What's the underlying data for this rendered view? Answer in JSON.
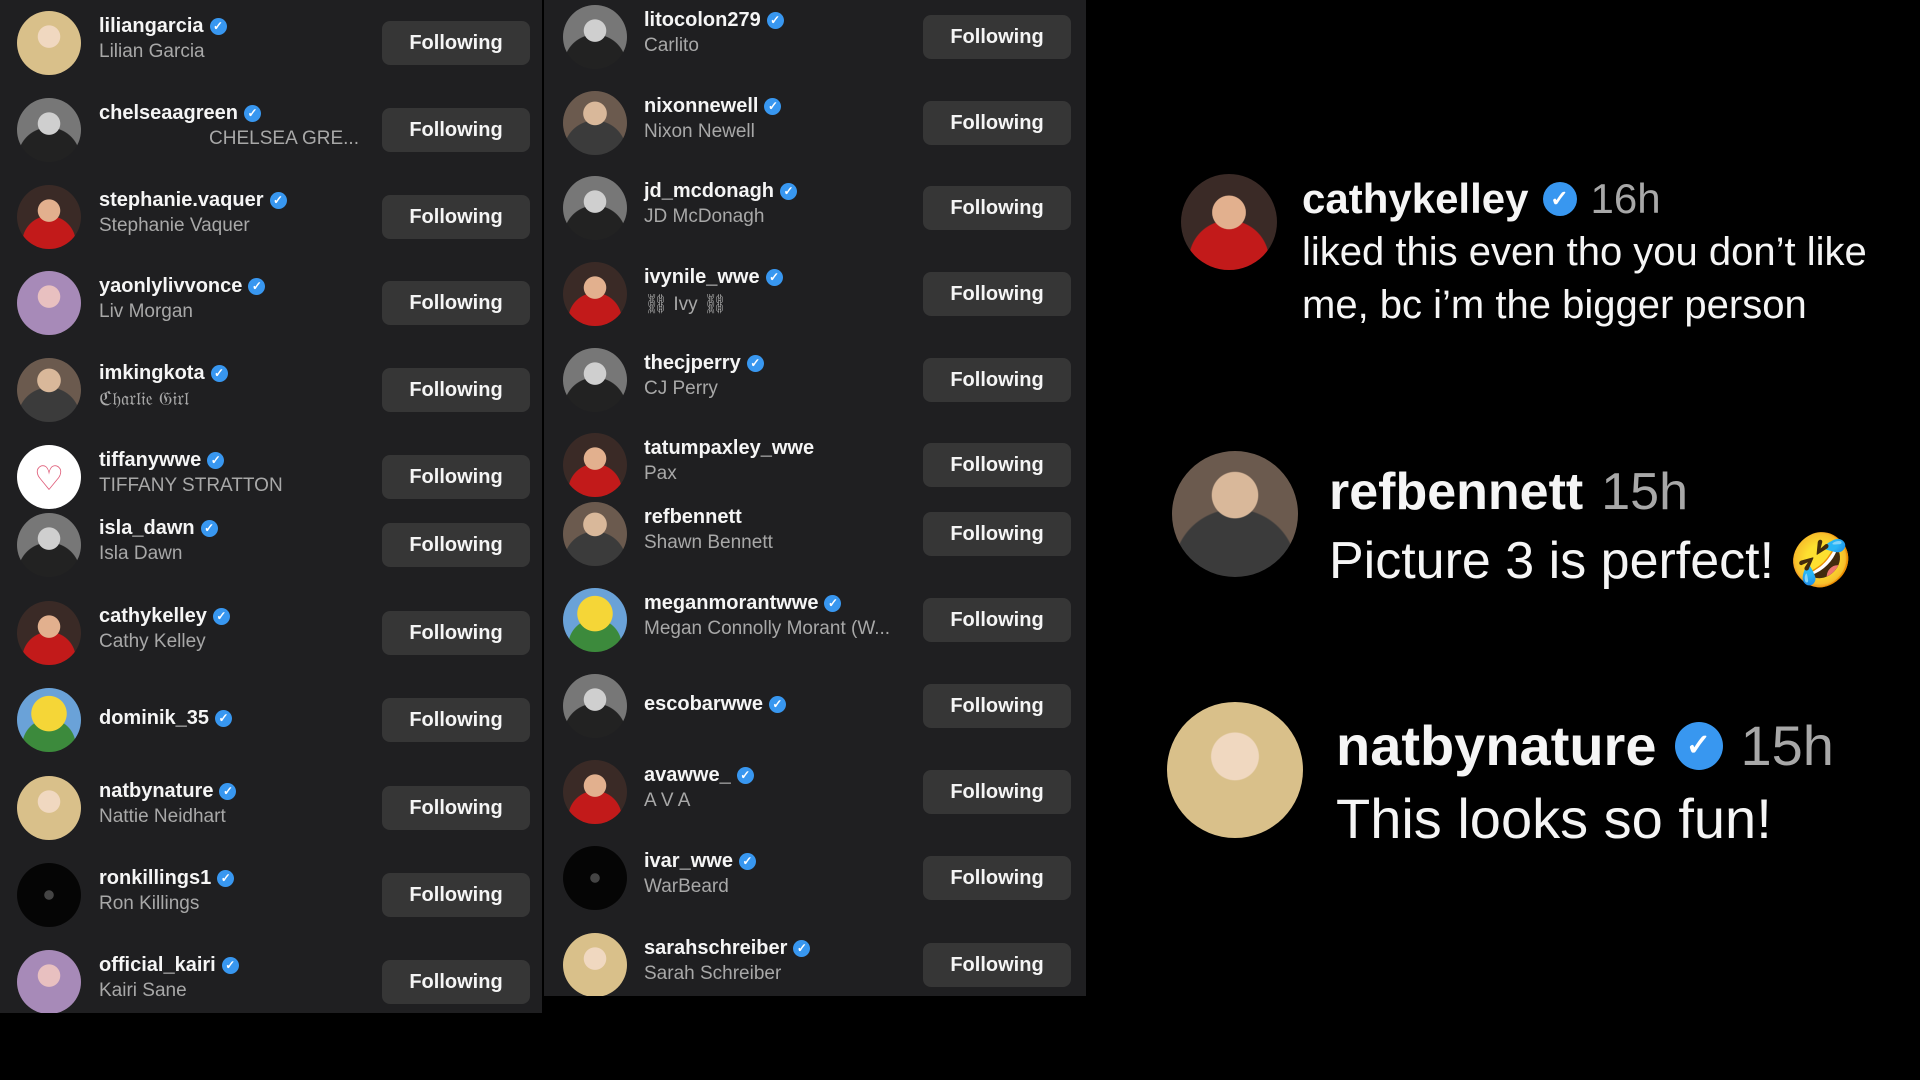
{
  "following_list_left": [
    {
      "username": "liliangarcia",
      "full_name": "Lilian Garcia",
      "button": "Following"
    },
    {
      "username": "chelseaagreen",
      "full_name": "CHELSEA GRE...",
      "button": "Following"
    },
    {
      "username": "stephanie.vaquer",
      "full_name": "Stephanie Vaquer",
      "button": "Following"
    },
    {
      "username": "yaonlylivvonce",
      "full_name": "Liv Morgan",
      "button": "Following"
    },
    {
      "username": "imkingkota",
      "full_name": "ℭ𝔥𝔞𝔯𝔩𝔦𝔢 𝔊𝔦𝔯𝔩",
      "button": "Following"
    },
    {
      "username": "tiffanywwe",
      "full_name": "TIFFANY STRATTON",
      "button": "Following"
    },
    {
      "username": "isla_dawn",
      "full_name": "Isla Dawn",
      "button": "Following"
    },
    {
      "username": "cathykelley",
      "full_name": "Cathy Kelley",
      "button": "Following"
    },
    {
      "username": "dominik_35",
      "full_name": "",
      "button": "Following"
    },
    {
      "username": "natbynature",
      "full_name": "Nattie Neidhart",
      "button": "Following"
    },
    {
      "username": "ronkillings1",
      "full_name": "Ron Killings",
      "button": "Following"
    },
    {
      "username": "official_kairi",
      "full_name": "Kairi Sane",
      "button": "Following"
    }
  ],
  "following_list_right": [
    {
      "username": "litocolon279",
      "full_name": "Carlito",
      "button": "Following"
    },
    {
      "username": "nixonnewell",
      "full_name": "Nixon Newell",
      "button": "Following"
    },
    {
      "username": "jd_mcdonagh",
      "full_name": "JD McDonagh",
      "button": "Following"
    },
    {
      "username": "ivynile_wwe",
      "full_name": "⛓ Ivy ⛓",
      "button": "Following"
    },
    {
      "username": "thecjperry",
      "full_name": "CJ Perry",
      "button": "Following"
    },
    {
      "username": "tatumpaxley_wwe",
      "full_name": "Pax",
      "button": "Following"
    },
    {
      "username": "refbennett",
      "full_name": "Shawn Bennett",
      "button": "Following"
    },
    {
      "username": "meganmorantwwe",
      "full_name": "Megan Connolly Morant (W...",
      "button": "Following"
    },
    {
      "username": "escobarwwe",
      "full_name": "",
      "button": "Following"
    },
    {
      "username": "avawwe_",
      "full_name": "A V A",
      "button": "Following"
    },
    {
      "username": "ivar_wwe",
      "full_name": "WarBeard",
      "button": "Following"
    },
    {
      "username": "sarahschreiber",
      "full_name": "Sarah Schreiber",
      "button": "Following"
    }
  ],
  "comments": [
    {
      "username": "cathykelley",
      "time": "16h",
      "line1": "liked this even tho you don’t like",
      "line2": "me, bc i’m the bigger person"
    },
    {
      "username": "refbennett",
      "time": "15h",
      "line1": "Picture 3 is perfect! 🤣",
      "line2": ""
    },
    {
      "username": "natbynature",
      "time": "15h",
      "line1": "This looks so fun!",
      "line2": ""
    }
  ],
  "colors": {
    "verified": "#3897f0",
    "button_bg": "#363636",
    "panel_bg": "#1f1f21",
    "secondary_text": "#a8a8a8"
  },
  "icons": {
    "verified": "verified-badge-icon"
  }
}
